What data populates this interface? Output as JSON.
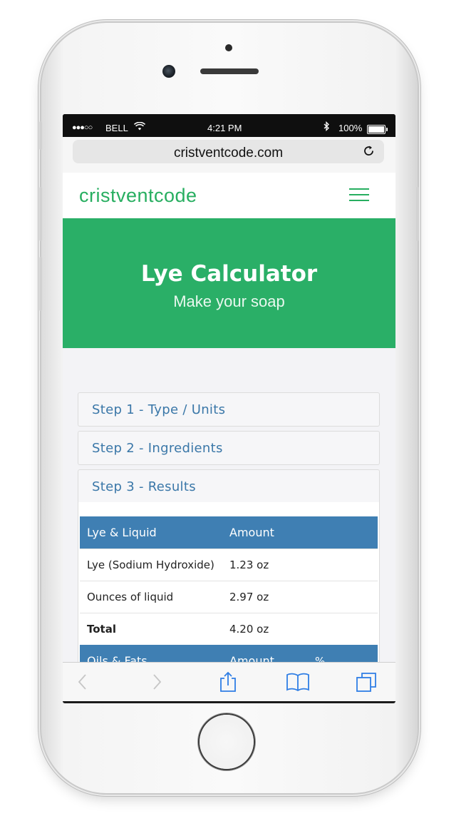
{
  "status_bar": {
    "signal": "●●●○○",
    "carrier": "BELL",
    "time": "4:21 PM",
    "battery_percent": "100%"
  },
  "browser": {
    "url": "cristventcode.com"
  },
  "site": {
    "brand": "cristventcode"
  },
  "hero": {
    "title": "Lye Calculator",
    "subtitle": "Make your soap"
  },
  "steps": [
    {
      "label": "Step 1 - Type / Units"
    },
    {
      "label": "Step 2 - Ingredients"
    },
    {
      "label": "Step 3 - Results"
    }
  ],
  "results_table": {
    "headers": [
      "Lye & Liquid",
      "Amount"
    ],
    "rows": [
      {
        "name": "Lye (Sodium Hydroxide)",
        "amount": "1.23 oz"
      },
      {
        "name": "Ounces of liquid",
        "amount": "2.97 oz"
      },
      {
        "name": "Total",
        "amount": "4.20 oz"
      }
    ],
    "next_headers": [
      "Oils & Fats",
      "Amount",
      "%"
    ]
  },
  "colors": {
    "brand_green": "#27ae60",
    "hero_green": "#2aaf67",
    "step_blue": "#3a77a8",
    "table_header_blue": "#3f7fb3"
  }
}
